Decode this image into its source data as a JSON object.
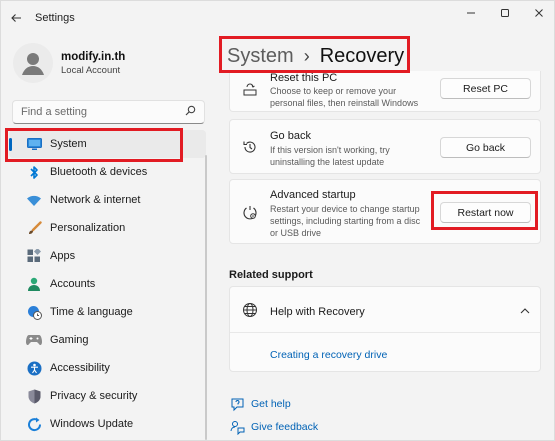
{
  "window": {
    "title": "Settings",
    "back_icon": "back-arrow-icon",
    "controls": [
      "minimize-icon",
      "maximize-icon",
      "close-icon"
    ]
  },
  "profile": {
    "name": "modify.in.th",
    "account_type": "Local Account"
  },
  "search": {
    "placeholder": "Find a setting"
  },
  "sidebar": {
    "items": [
      {
        "label": "System",
        "icon": "monitor-icon",
        "color": "#0078d4",
        "active": true
      },
      {
        "label": "Bluetooth & devices",
        "icon": "bluetooth-icon",
        "color": "#0078d4"
      },
      {
        "label": "Network & internet",
        "icon": "wifi-icon",
        "color": "#3a8fd8"
      },
      {
        "label": "Personalization",
        "icon": "paintbrush-icon",
        "color": "#d68a3a"
      },
      {
        "label": "Apps",
        "icon": "apps-icon",
        "color": "#4a5a6a"
      },
      {
        "label": "Accounts",
        "icon": "person-icon",
        "color": "#2aa876"
      },
      {
        "label": "Time & language",
        "icon": "globe-clock-icon",
        "color": "#2b7fd8"
      },
      {
        "label": "Gaming",
        "icon": "gamepad-icon",
        "color": "#7a7a7a"
      },
      {
        "label": "Accessibility",
        "icon": "accessibility-icon",
        "color": "#1a6fc4"
      },
      {
        "label": "Privacy & security",
        "icon": "shield-icon",
        "color": "#7a7a8a"
      },
      {
        "label": "Windows Update",
        "icon": "update-icon",
        "color": "#1a7fd8"
      }
    ]
  },
  "breadcrumb": {
    "parent": "System",
    "separator": "›",
    "current": "Recovery"
  },
  "recovery_options": [
    {
      "title": "Reset this PC",
      "description": "Choose to keep or remove your personal files, then reinstall Windows",
      "button": "Reset PC",
      "icon": "reset-pc-icon"
    },
    {
      "title": "Go back",
      "description": "If this version isn't working, try uninstalling the latest update",
      "button": "Go back",
      "icon": "history-icon"
    },
    {
      "title": "Advanced startup",
      "description": "Restart your device to change startup settings, including starting from a disc or USB drive",
      "button": "Restart now",
      "icon": "advanced-startup-icon"
    }
  ],
  "related_support": {
    "heading": "Related support",
    "help_title": "Help with Recovery",
    "help_icon": "globe-icon",
    "expand_icon": "chevron-up-icon",
    "link": "Creating a recovery drive"
  },
  "footer": {
    "get_help": "Get help",
    "give_feedback": "Give feedback"
  },
  "colors": {
    "accent": "#0067c0",
    "link": "#0062b5",
    "highlight": "#e21b23"
  }
}
